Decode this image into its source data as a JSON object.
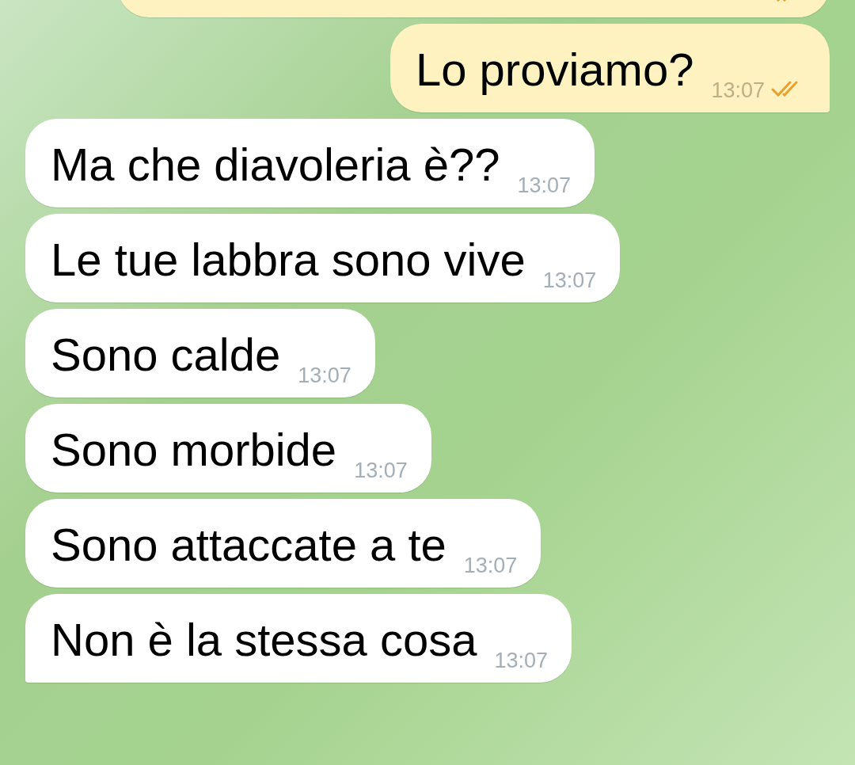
{
  "messages": [
    {
      "kind": "outgoing",
      "read": true,
      "tail": false
    },
    {
      "kind": "outgoing",
      "text": "Lo proviamo?",
      "time": "13:07",
      "read": true,
      "tail": true
    },
    {
      "kind": "incoming",
      "text": "Ma che diavoleria è??",
      "time": "13:07",
      "tail": false
    },
    {
      "kind": "incoming",
      "text": "Le tue labbra sono vive",
      "time": "13:07",
      "tail": false
    },
    {
      "kind": "incoming",
      "text": "Sono calde",
      "time": "13:07",
      "tail": false
    },
    {
      "kind": "incoming",
      "text": "Sono morbide",
      "time": "13:07",
      "tail": false
    },
    {
      "kind": "incoming",
      "text": "Sono attaccate a te",
      "time": "13:07",
      "tail": false
    },
    {
      "kind": "incoming",
      "text": "Non è la stessa cosa",
      "time": "13:07",
      "tail": true
    }
  ]
}
